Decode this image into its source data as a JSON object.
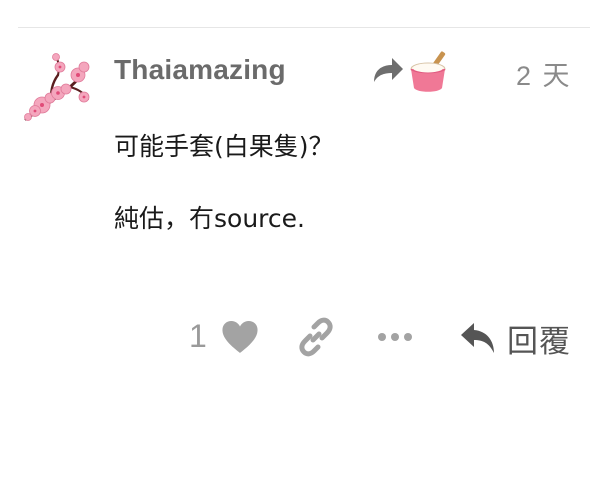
{
  "post": {
    "username": "Thaiamazing",
    "date": "2 天",
    "body": [
      "可能手套(白果隻)？",
      "純估，冇source."
    ]
  },
  "actions": {
    "like_count": "1",
    "reply_label": "回覆"
  },
  "icons": {
    "avatar": "plum-blossom-branch",
    "reply_to": "share-arrow-icon",
    "reply_to_avatar": "ice-cream-cup",
    "like": "heart-icon",
    "link": "link-icon",
    "more": "ellipsis-icon",
    "reply": "reply-arrow-icon"
  },
  "colors": {
    "username": "#6b6b6b",
    "date": "#8a8a8a",
    "action_icon": "#9a9a9a",
    "reply_icon": "#555555",
    "divider": "#e6e6e6",
    "blossom": "#f4a6bd",
    "cup": "#f07896"
  }
}
